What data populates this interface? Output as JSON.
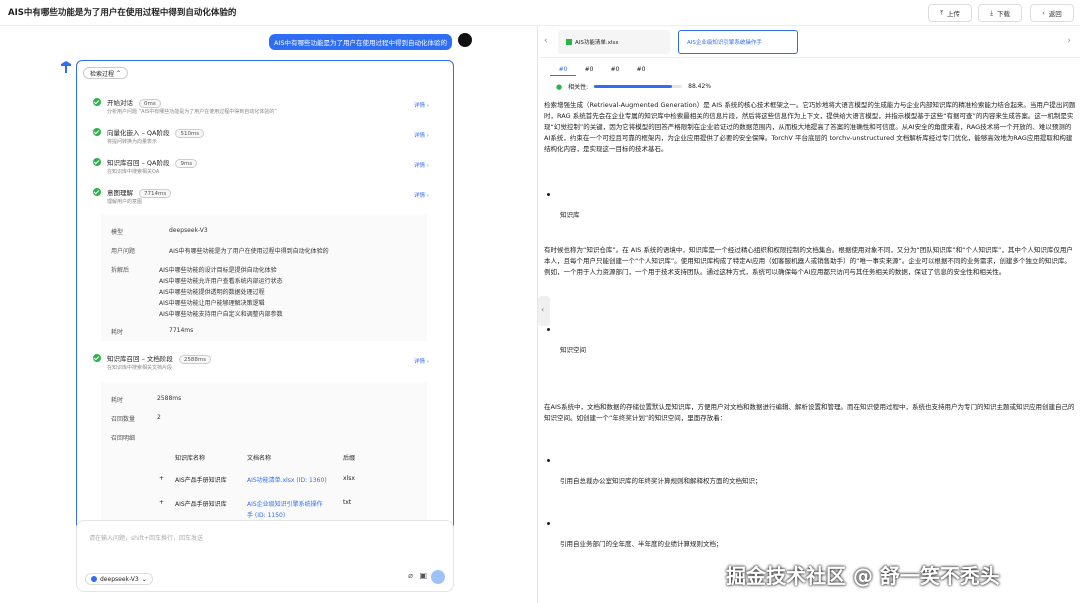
{
  "header": {
    "title": "AIS中有哪些功能是为了用户在使用过程中得到自动化体验的",
    "upload": "上传",
    "download": "下载",
    "back": "返回"
  },
  "chat": {
    "user_message": "AIS中有哪些功能是为了用户在使用过程中得到自动化体验的",
    "process_toggle": "检索过程",
    "steps": [
      {
        "name": "开始对话",
        "time": "0ms",
        "desc": "分析用户问题 “AIS中有哪些功能是为了用户在使用过程中得到自动化体验的”",
        "detail": "详情"
      },
      {
        "name": "向量化嵌入 – QA阶段",
        "time": "510ms",
        "desc": "将提问转换为向量表示",
        "detail": "详情"
      },
      {
        "name": "知识库召回 – QA阶段",
        "time": "9ms",
        "desc": "在知识库中搜索相关QA",
        "detail": "详情"
      },
      {
        "name": "意图理解",
        "time": "7714ms",
        "desc": "理解用户的意图",
        "detail": "详情"
      },
      {
        "name": "知识库召回 – 文档阶段",
        "time": "2588ms",
        "desc": "在知识库中搜索相关文档片段",
        "detail": "详情"
      }
    ],
    "intent": {
      "model_label": "模型",
      "model_value": "deepseek-V3",
      "question_label": "用户问题",
      "question_value": "AIS中有哪些功能是为了用户在使用过程中得到自动化体验的",
      "split_label": "拆解后",
      "split_items": [
        "AIS中哪些功能的设计目标是提供自动化体验",
        "AIS中哪些功能允许用户查看系统内部运行状态",
        "AIS中哪些功能提供透明的数据处理过程",
        "AIS中哪些功能让用户能够理解决策逻辑",
        "AIS中哪些功能支持用户自定义和调整内部参数"
      ],
      "time_label": "耗时",
      "time_value": "7714ms"
    },
    "recall": {
      "time_label": "耗时",
      "time_value": "2588ms",
      "count_label": "召回数量",
      "count_value": "2",
      "details_label": "召回明细",
      "columns": [
        "知识库名称",
        "文档名称",
        "后缀"
      ],
      "rows": [
        {
          "kb": "AIS产品手册知识库",
          "doc": "AIS功能清单.xlsx (ID: 1360)",
          "ext": "xlsx"
        },
        {
          "kb": "AIS产品手册知识库",
          "doc": "AIS企业级知识引擎系统操作",
          "doc2": "手 (ID: 1150)",
          "ext": "txt"
        }
      ]
    },
    "input_placeholder": "请在输入问题，shift+回车换行，回车发送",
    "model_selector": "deepseek-V3"
  },
  "preview": {
    "file_tabs": [
      "AIS功能清单.xlsx",
      "AIS企业级知识引擎系统操作手"
    ],
    "chunk_tabs": [
      "#0",
      "#0",
      "#0",
      "#0"
    ],
    "relevance_label": "相关性:",
    "relevance_value": "88.42%",
    "relevance_fraction": 0.8842,
    "intro": "检索增强生成（Retrieval-Augmented Generation）是 AIS 系统的核心技术框架之一。它巧妙地将大语言模型的生成能力与企业内部知识库的精准检索能力结合起来。当用户提出问题时，RAG 系统首先会在企业专属的知识库中检索最相关的信息片段，然后将这些信息作为上下文，提供给大语言模型，并指示模型基于这些“有据可查”的内容来生成答案。这一机制是实现“幻觉控制”的关键，因为它将模型的回答严格限制在企业验证过的数据范围内，从而极大地提高了答案的准确性和可信度。从AI安全的角度来看，RAG技术将一个开放的、难以预测的AI系统，约束在一个可控且可靠的框架内，为企业应用提供了必要的安全保障。TorchV 平台底层的 torchv-unstructured 文档解析库经过专门优化，能够高效地为RAG应用提取和构建结构化内容，是实现这一目标的技术基石。",
    "h_kb": "知识库",
    "kb_text": "有时候也称为“知识仓库”。在 AIS 系统的语境中，知识库是一个经过精心组织和权限控制的文档集合。根据使用对象不同，又分为“团队知识库”和“个人知识库”，其中个人知识库仅用户本人，且每个用户只能创建一个“个人知识库”。使用知识库构成了特定AI应用（如客服机器人或销售助手）的“唯一事实来源”。企业可以根据不同的业务需求，创建多个独立的知识库。例如，一个用于人力资源部门，一个用于技术支持团队。通过这种方式，系统可以确保每个AI应用都只访问与其任务相关的数据，保证了信息的安全性和相关性。",
    "h_space": "知识空间",
    "space_text": "在AIS系统中，文档和数据的存储位置默认是知识库，方便用户对文档和数据进行编辑、解析设置和管理。而在知识使用过程中，系统也支持用户为专门的知识主题或知识应用创建自己的知识空间。如创建一个“年终奖计划”的知识空间，里面存放着：",
    "item1": "引用自总裁办公室知识库的年终奖计算规则和解释权方面的文档知识；",
    "item2": "引用自业务部门的全年度、半年度的业绩计算规则文档；"
  },
  "watermark": "掘金技术社区 @ 舒一笑不秃头"
}
